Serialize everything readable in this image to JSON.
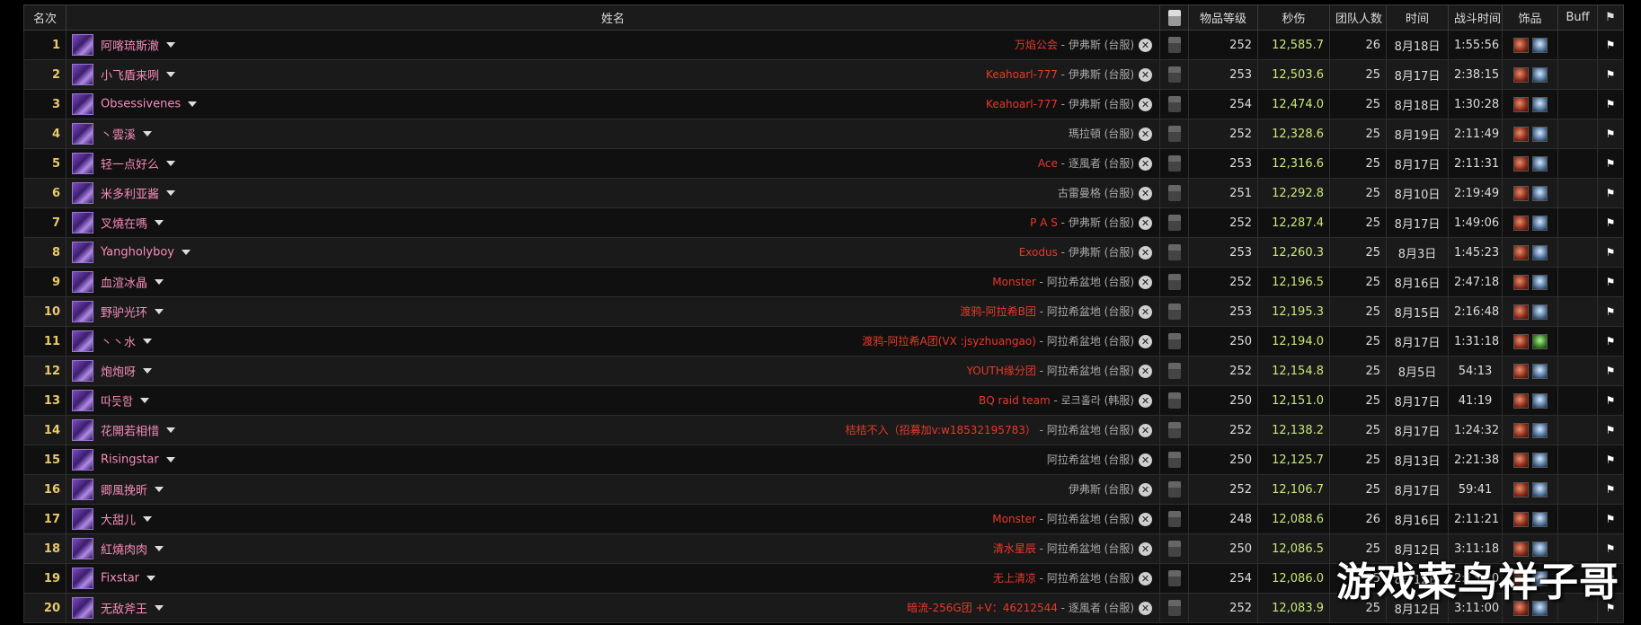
{
  "headers": {
    "rank": "名次",
    "name": "姓名",
    "video_icon": "youtube-icon",
    "ilvl": "物品等级",
    "dps": "秒伤",
    "raid_size": "团队人数",
    "date": "时间",
    "duration": "战斗时间",
    "trinkets": "饰品",
    "buff": "Buff",
    "flag_glyph": "⚑"
  },
  "colors": {
    "player_name": "#f58cba",
    "guild": "#e8392a",
    "dps": "#c8e67a",
    "rank": "#e8c96b"
  },
  "rows": [
    {
      "rank": "1",
      "name": "阿喀琉斯澈",
      "guild": "万焰公会",
      "server": " - 伊弗斯 (台服)",
      "ilvl": "252",
      "dps": "12,585.7",
      "size": "26",
      "date": "8月18日",
      "dur": "1:55:56",
      "t2": "frost"
    },
    {
      "rank": "2",
      "name": "小飞盾来咧",
      "guild": "Keahoarl-777",
      "server": " - 伊弗斯 (台服)",
      "ilvl": "253",
      "dps": "12,503.6",
      "size": "25",
      "date": "8月17日",
      "dur": "2:38:15",
      "t2": "frost"
    },
    {
      "rank": "3",
      "name": "Obsessivenes",
      "guild": "Keahoarl-777",
      "server": " - 伊弗斯 (台服)",
      "ilvl": "254",
      "dps": "12,474.0",
      "size": "25",
      "date": "8月18日",
      "dur": "1:30:28",
      "t2": "frost"
    },
    {
      "rank": "4",
      "name": "丶雲溪",
      "guild": "",
      "server": "瑪拉頓 (台服)",
      "ilvl": "252",
      "dps": "12,328.6",
      "size": "25",
      "date": "8月19日",
      "dur": "2:11:49",
      "t2": "frost"
    },
    {
      "rank": "5",
      "name": "轻一点好么",
      "guild": "Ace",
      "server": " - 逐風者 (台服)",
      "ilvl": "253",
      "dps": "12,316.6",
      "size": "25",
      "date": "8月17日",
      "dur": "2:11:31",
      "t2": "frost"
    },
    {
      "rank": "6",
      "name": "米多利亚酱",
      "guild": "",
      "server": "古雷曼格 (台服)",
      "ilvl": "251",
      "dps": "12,292.8",
      "size": "25",
      "date": "8月10日",
      "dur": "2:19:49",
      "t2": "frost"
    },
    {
      "rank": "7",
      "name": "叉燒在嗎",
      "guild": "P A S",
      "server": " - 伊弗斯 (台服)",
      "ilvl": "252",
      "dps": "12,287.4",
      "size": "25",
      "date": "8月17日",
      "dur": "1:49:06",
      "t2": "frost"
    },
    {
      "rank": "8",
      "name": "Yangholyboy",
      "guild": "Exodus",
      "server": " - 伊弗斯 (台服)",
      "ilvl": "253",
      "dps": "12,260.3",
      "size": "25",
      "date": "8月3日",
      "dur": "1:45:23",
      "t2": "frost"
    },
    {
      "rank": "9",
      "name": "血渲冰晶",
      "guild": "Monster",
      "server": " - 阿拉希盆地 (台服)",
      "ilvl": "252",
      "dps": "12,196.5",
      "size": "25",
      "date": "8月16日",
      "dur": "2:47:18",
      "t2": "frost"
    },
    {
      "rank": "10",
      "name": "野驴光环",
      "guild": "渡鸦-阿拉希B团",
      "server": " - 阿拉希盆地 (台服)",
      "ilvl": "253",
      "dps": "12,195.3",
      "size": "25",
      "date": "8月15日",
      "dur": "2:16:48",
      "t2": "frost"
    },
    {
      "rank": "11",
      "name": "丶丶水",
      "guild": "渡鸦-阿拉希A团(VX :jsyzhuangao)",
      "server": " - 阿拉希盆地 (台服)",
      "ilvl": "250",
      "dps": "12,194.0",
      "size": "25",
      "date": "8月17日",
      "dur": "1:31:18",
      "t2": "green"
    },
    {
      "rank": "12",
      "name": "炮炮呀",
      "guild": "YOUTH缘分团",
      "server": " - 阿拉希盆地 (台服)",
      "ilvl": "252",
      "dps": "12,154.8",
      "size": "25",
      "date": "8月5日",
      "dur": "54:13",
      "t2": "frost"
    },
    {
      "rank": "13",
      "name": "따듯함",
      "guild": "BQ raid team",
      "server": " - 로크홀라 (韩服)",
      "ilvl": "250",
      "dps": "12,151.0",
      "size": "25",
      "date": "8月17日",
      "dur": "41:19",
      "t2": "frost"
    },
    {
      "rank": "14",
      "name": "花開若相惜",
      "guild": "桔桔不入（招募加v:w18532195783）",
      "server": " - 阿拉希盆地 (台服)",
      "ilvl": "252",
      "dps": "12,138.2",
      "size": "25",
      "date": "8月17日",
      "dur": "1:24:32",
      "t2": "frost"
    },
    {
      "rank": "15",
      "name": "Risingstar",
      "guild": "",
      "server": "阿拉希盆地 (台服)",
      "ilvl": "250",
      "dps": "12,125.7",
      "size": "25",
      "date": "8月13日",
      "dur": "2:21:38",
      "t2": "frost"
    },
    {
      "rank": "16",
      "name": "卿風挽昕",
      "guild": "",
      "server": "伊弗斯 (台服)",
      "ilvl": "252",
      "dps": "12,106.7",
      "size": "25",
      "date": "8月17日",
      "dur": "59:41",
      "t2": "frost"
    },
    {
      "rank": "17",
      "name": "大甜儿",
      "guild": "Monster",
      "server": " - 阿拉希盆地 (台服)",
      "ilvl": "248",
      "dps": "12,088.6",
      "size": "26",
      "date": "8月16日",
      "dur": "2:11:21",
      "t2": "frost"
    },
    {
      "rank": "18",
      "name": "紅燒肉肉",
      "guild": "清水星辰",
      "server": " - 阿拉希盆地 (台服)",
      "ilvl": "250",
      "dps": "12,086.5",
      "size": "25",
      "date": "8月12日",
      "dur": "3:11:18",
      "t2": "frost"
    },
    {
      "rank": "19",
      "name": "Fixstar",
      "guild": "无上清凉",
      "server": " - 阿拉希盆地 (台服)",
      "ilvl": "254",
      "dps": "12,086.0",
      "size": "25",
      "date": "8月12日",
      "dur": "2:13:20",
      "t2": "frost"
    },
    {
      "rank": "20",
      "name": "无敌斧王",
      "guild": "暗流-256G团 +V：46212544",
      "server": " - 逐風者 (台服)",
      "ilvl": "252",
      "dps": "12,083.9",
      "size": "25",
      "date": "8月12日",
      "dur": "3:11:00",
      "t2": "frost"
    }
  ],
  "watermark": "游戏菜鸟祥子哥"
}
